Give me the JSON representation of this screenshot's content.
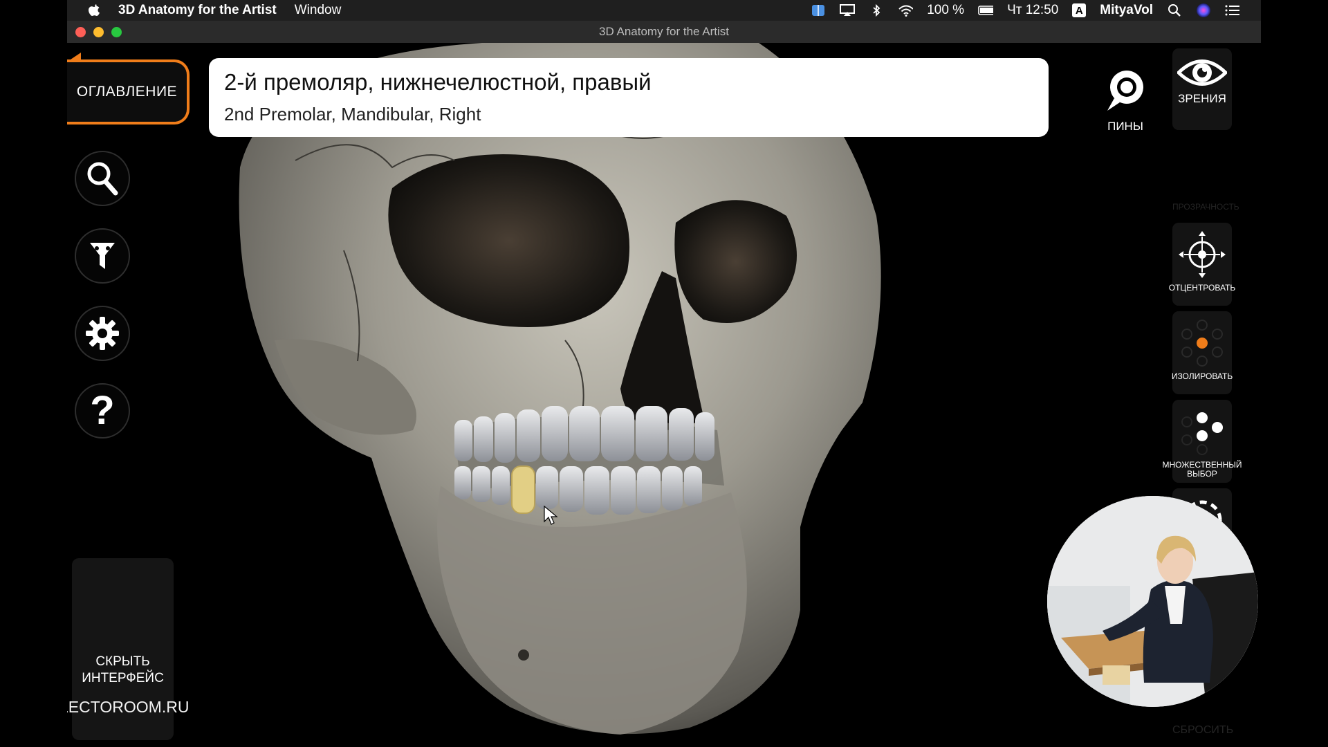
{
  "menubar": {
    "app_name": "3D Anatomy for the Artist",
    "menu_window": "Window",
    "battery": "100 %",
    "clock": "Чт 12:50",
    "input_lang": "A",
    "user": "MityaVol"
  },
  "window": {
    "title": "3D Anatomy for the Artist"
  },
  "left_panel": {
    "toc_label": "ОГЛАВЛЕНИЕ",
    "hide_ui_label": "СКРЫТЬ ИНТЕРФЕЙС"
  },
  "selection": {
    "name_ru": "2-й премоляр, нижнечелюстной, правый",
    "name_en": "2nd Premolar, Mandibular, Right"
  },
  "right_panel": {
    "pins_label": "ПИНЫ",
    "views_label": "ЗРЕНИЯ",
    "transparency_label": "ПРОЗРАЧНОСТЬ",
    "center_label": "ОТЦЕНТРОВАТЬ",
    "isolate_label": "ИЗОЛИРОВАТЬ",
    "multiselect_label": "МНОЖЕСТВЕННЫЙ ВЫБОР",
    "reset_label": "СБРОСИТЬ"
  },
  "watermark": "LECTOROOM.RU",
  "colors": {
    "accent": "#f07d1a",
    "selected_tooth": "#e2cf85",
    "bone": "#a8a59c"
  }
}
